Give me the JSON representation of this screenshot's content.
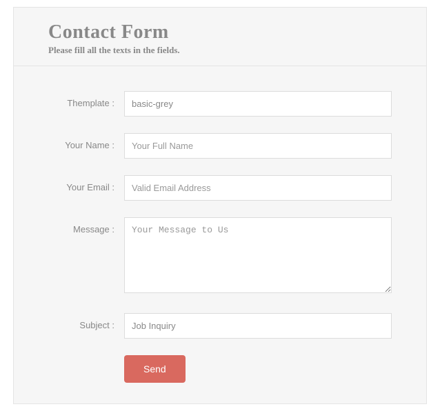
{
  "header": {
    "title": "Contact Form",
    "subtitle": "Please fill all the texts in the fields."
  },
  "fields": {
    "template": {
      "label": "Themplate :",
      "value": "basic-grey"
    },
    "name": {
      "label": "Your Name :",
      "placeholder": "Your Full Name"
    },
    "email": {
      "label": "Your Email :",
      "placeholder": "Valid Email Address"
    },
    "message": {
      "label": "Message :",
      "placeholder": "Your Message to Us"
    },
    "subject": {
      "label": "Subject :",
      "value": "Job Inquiry"
    }
  },
  "button": {
    "send": "Send"
  }
}
